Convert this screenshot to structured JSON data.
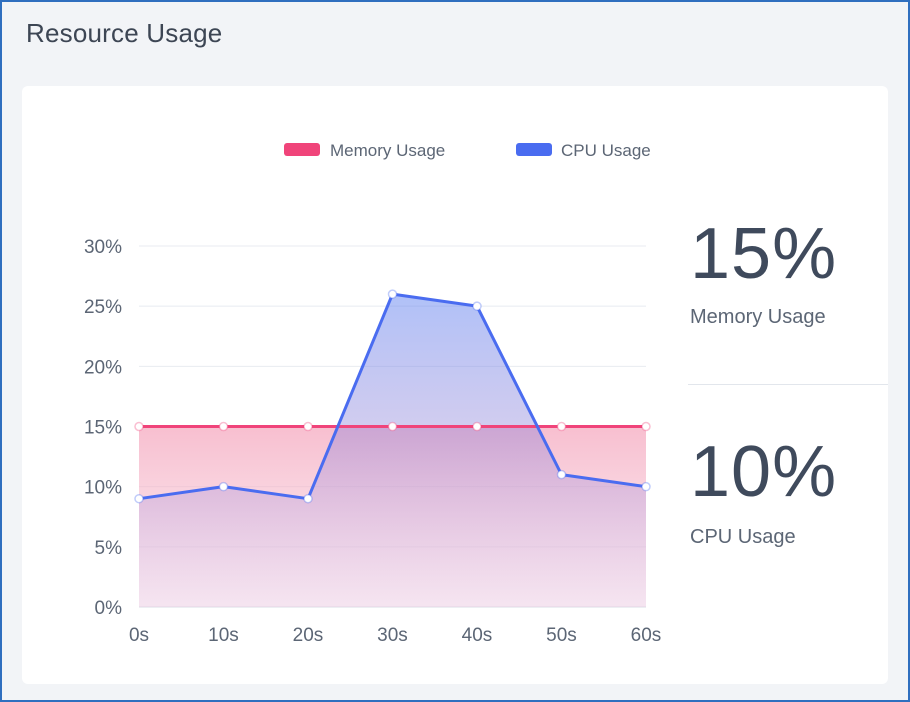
{
  "panel": {
    "title": "Resource Usage"
  },
  "stats": {
    "memory_value": "15%",
    "memory_label": "Memory Usage",
    "cpu_value": "10%",
    "cpu_label": "CPU Usage"
  },
  "chart_data": {
    "type": "area",
    "title": "",
    "xlabel": "",
    "ylabel": "",
    "x": [
      "0s",
      "10s",
      "20s",
      "30s",
      "40s",
      "50s",
      "60s"
    ],
    "ylim": [
      0,
      30
    ],
    "y_ticks": [
      "0%",
      "5%",
      "10%",
      "15%",
      "20%",
      "25%",
      "30%"
    ],
    "grid": true,
    "legend_position": "top-center",
    "series": [
      {
        "name": "Memory Usage",
        "values": [
          15,
          15,
          15,
          15,
          15,
          15,
          15
        ],
        "color": "#f0447a"
      },
      {
        "name": "CPU Usage",
        "values": [
          9,
          10,
          9,
          26,
          25,
          11,
          10
        ],
        "color": "#4a6cf0"
      }
    ]
  }
}
